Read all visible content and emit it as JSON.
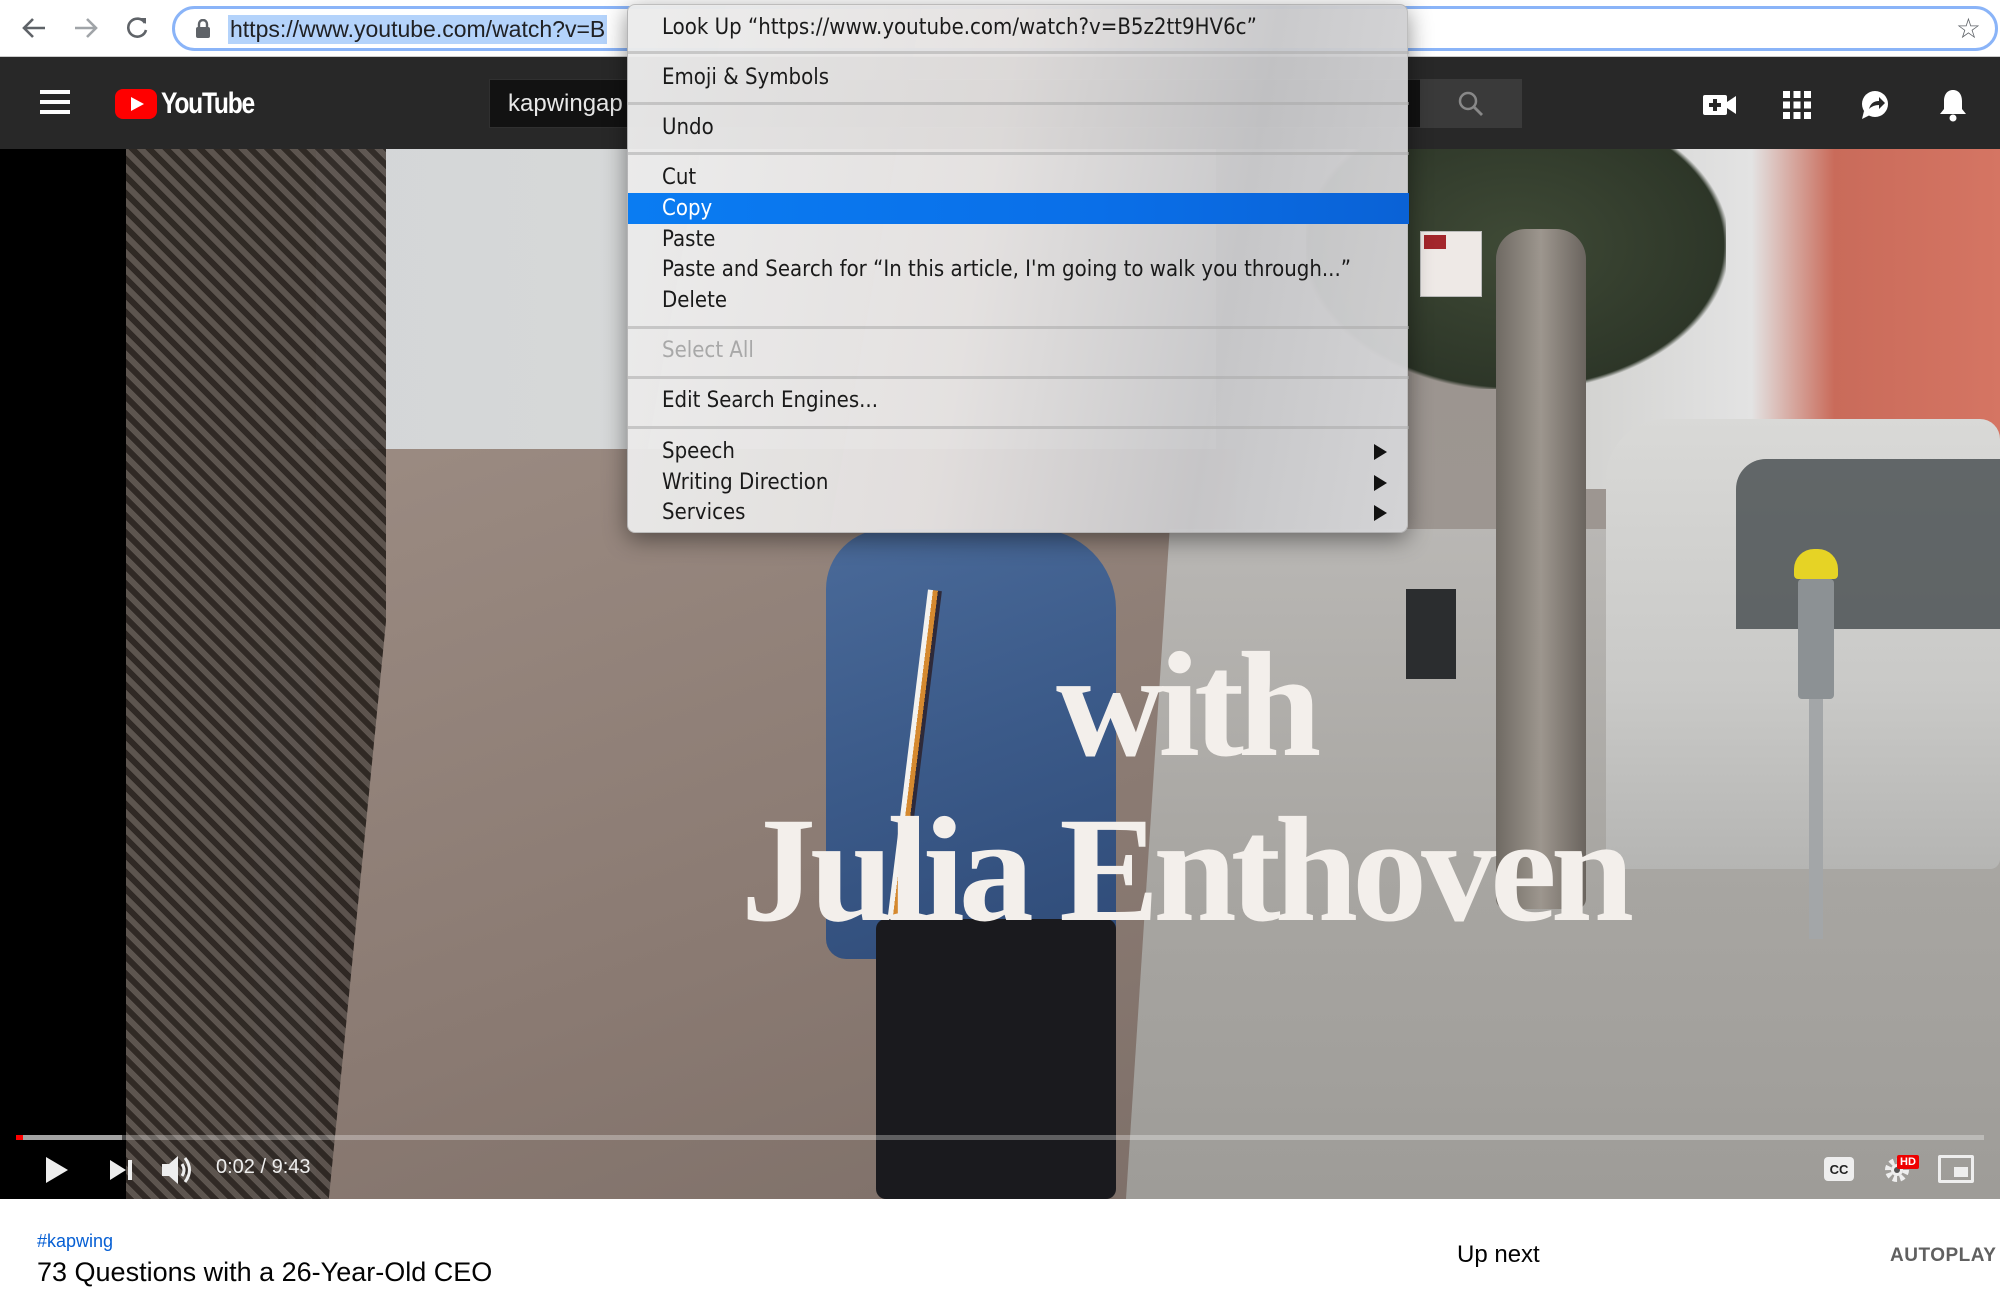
{
  "browser": {
    "url": "https://www.youtube.com/watch?v=B",
    "nav_icons": [
      "back-arrow-icon",
      "forward-arrow-icon",
      "reload-icon"
    ],
    "secure_icon": "lock-icon",
    "bookmark_icon": "star-icon"
  },
  "youtube_header": {
    "logo_text": "YouTube",
    "search_value": "kapwingap",
    "icons": [
      "create-video-icon",
      "apps-grid-icon",
      "messages-icon",
      "notifications-bell-icon"
    ]
  },
  "video": {
    "overlay_line1": "with",
    "overlay_line2": "Julia Enthoven",
    "time_display": "0:02 / 9:43",
    "progress_played_fraction": 0.0035,
    "progress_buffered_fraction": 0.054,
    "quality_badge": "HD",
    "cc_label": "CC"
  },
  "below_video": {
    "hashtag": "#kapwing",
    "title": "73 Questions with a 26-Year-Old CEO",
    "up_next": "Up next",
    "autoplay": "AUTOPLAY"
  },
  "context_menu": {
    "items": [
      {
        "label": "Look Up “https://www.youtube.com/watch?v=B5z2tt9HV6c”",
        "state": "normal"
      },
      {
        "label": "Emoji & Symbols",
        "state": "normal"
      },
      {
        "label": "Undo",
        "state": "normal"
      },
      {
        "label": "Cut",
        "state": "normal"
      },
      {
        "label": "Copy",
        "state": "selected"
      },
      {
        "label": "Paste",
        "state": "normal"
      },
      {
        "label": "Paste and Search for “In this article, I'm going to walk you through...”",
        "state": "normal"
      },
      {
        "label": "Delete",
        "state": "normal"
      },
      {
        "label": "Select All",
        "state": "disabled"
      },
      {
        "label": "Edit Search Engines...",
        "state": "normal"
      },
      {
        "label": "Speech",
        "state": "submenu"
      },
      {
        "label": "Writing Direction",
        "state": "submenu"
      },
      {
        "label": "Services",
        "state": "submenu"
      }
    ]
  },
  "colors": {
    "selection_blue": "#0a6fe8",
    "youtube_red": "#ff0000",
    "hashtag_blue": "#065fd4",
    "header_bg": "#282828"
  }
}
